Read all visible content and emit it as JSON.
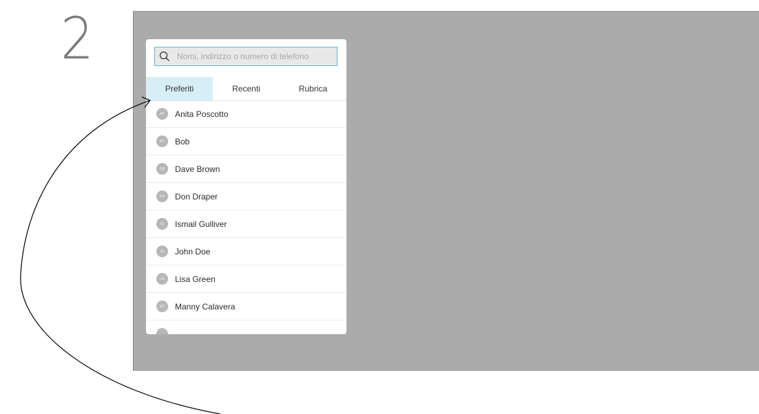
{
  "step": "2",
  "search": {
    "placeholder": "Nomi, indirizzo o numero di telefono",
    "value": ""
  },
  "tabs": [
    {
      "label": "Preferiti",
      "active": true
    },
    {
      "label": "Recenti",
      "active": false
    },
    {
      "label": "Rubrica",
      "active": false
    }
  ],
  "contacts": [
    {
      "initials": "AP",
      "name": "Anita Poscotto"
    },
    {
      "initials": "BO",
      "name": "Bob"
    },
    {
      "initials": "DB",
      "name": "Dave Brown"
    },
    {
      "initials": "DD",
      "name": "Don Draper"
    },
    {
      "initials": "IG",
      "name": "Ismail Gulliver"
    },
    {
      "initials": "JD",
      "name": "John Doe"
    },
    {
      "initials": "LG",
      "name": "Lisa Green"
    },
    {
      "initials": "MC",
      "name": "Manny Calavera"
    },
    {
      "initials": "",
      "name": ""
    }
  ],
  "colors": {
    "screen": "#ababab",
    "tab_active": "#d7eef6",
    "search_border": "#6bb3cf"
  }
}
